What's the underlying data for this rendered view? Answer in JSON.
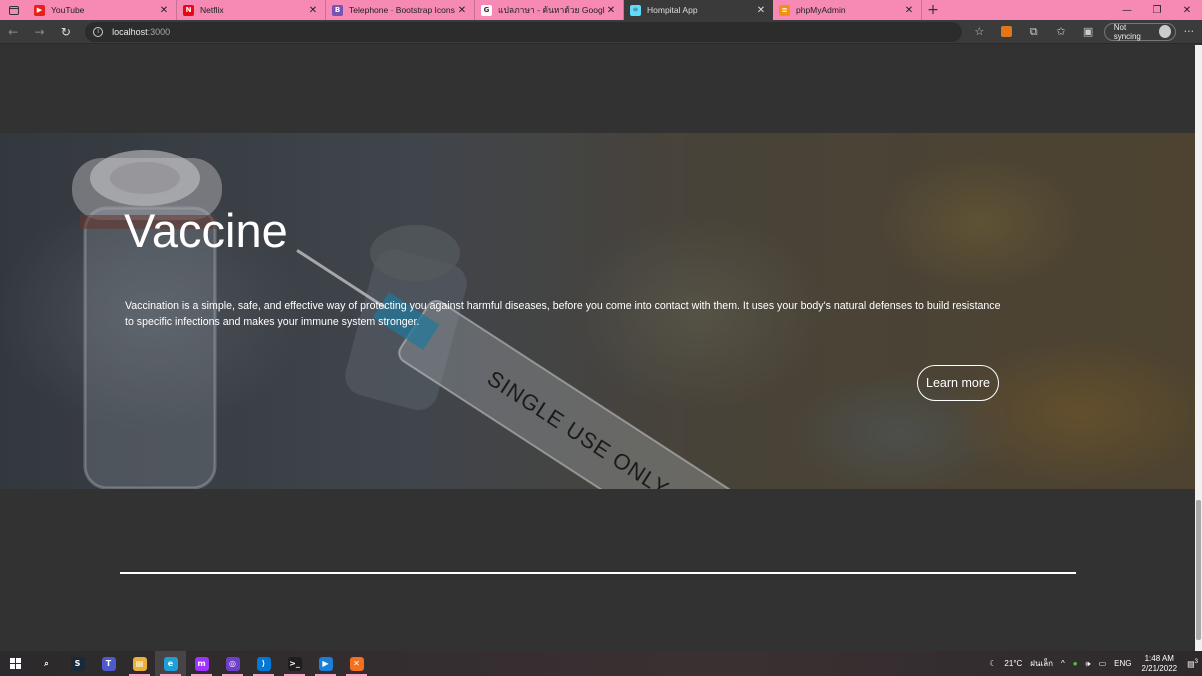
{
  "browser": {
    "tabs": [
      {
        "label": "YouTube",
        "icon": "youtube-icon",
        "color": "#e62117",
        "glyph": "▶",
        "active": false
      },
      {
        "label": "Netflix",
        "icon": "netflix-icon",
        "color": "#e50914",
        "glyph": "N",
        "active": false
      },
      {
        "label": "Telephone · Bootstrap Icons",
        "icon": "bootstrap-icon",
        "color": "#7952b3",
        "glyph": "B",
        "active": false
      },
      {
        "label": "แปลภาษา - ค้นหาด้วย Google",
        "icon": "google-icon",
        "color": "#ffffff",
        "glyph": "G",
        "active": false
      },
      {
        "label": "Hompital App",
        "icon": "react-app-icon",
        "color": "#61dafb",
        "glyph": "⚛",
        "active": true
      },
      {
        "label": "phpMyAdmin",
        "icon": "phpmyadmin-icon",
        "color": "#f29111",
        "glyph": "≡",
        "active": false
      }
    ],
    "url_host": "localhost",
    "url_port": ":3000",
    "sync_label": "Not syncing"
  },
  "hero": {
    "title": "Vaccine",
    "description": "Vaccination is a simple, safe, and effective way of protecting you against harmful diseases, before you come into contact with them. It uses your body's natural defenses to build resistance to specific infections and makes your immune system stronger.",
    "button_label": "Learn more",
    "syringe_text": "SINGLE USE ONLY"
  },
  "taskbar": {
    "apps": [
      {
        "name": "search-icon",
        "color": "transparent",
        "glyph": "⌕",
        "open": false,
        "active": false
      },
      {
        "name": "steam-icon",
        "color": "#1b2838",
        "glyph": "S",
        "open": false,
        "active": false
      },
      {
        "name": "teams-icon",
        "color": "#5059c9",
        "glyph": "T",
        "open": false,
        "active": false
      },
      {
        "name": "file-explorer-icon",
        "color": "#e8b23a",
        "glyph": "▤",
        "open": true,
        "active": false
      },
      {
        "name": "edge-icon",
        "color": "#1f9ed8",
        "glyph": "e",
        "open": true,
        "active": true
      },
      {
        "name": "messenger-icon",
        "color": "#a033ff",
        "glyph": "m",
        "open": true,
        "active": false
      },
      {
        "name": "github-desktop-icon",
        "color": "#6e40c9",
        "glyph": "◎",
        "open": true,
        "active": false
      },
      {
        "name": "vscode-icon",
        "color": "#0078d4",
        "glyph": "⟩",
        "open": true,
        "active": false
      },
      {
        "name": "terminal-icon",
        "color": "#1e1e1e",
        "glyph": ">_",
        "open": true,
        "active": false
      },
      {
        "name": "media-player-icon",
        "color": "#1a7fd6",
        "glyph": "▶",
        "open": true,
        "active": false
      },
      {
        "name": "xampp-icon",
        "color": "#f37021",
        "glyph": "✕",
        "open": true,
        "active": false
      }
    ],
    "temperature": "21°C",
    "weather_text": "ฝนเล็ก",
    "language": "ENG",
    "time": "1:48 AM",
    "date": "2/21/2022",
    "notification_count": "3"
  }
}
